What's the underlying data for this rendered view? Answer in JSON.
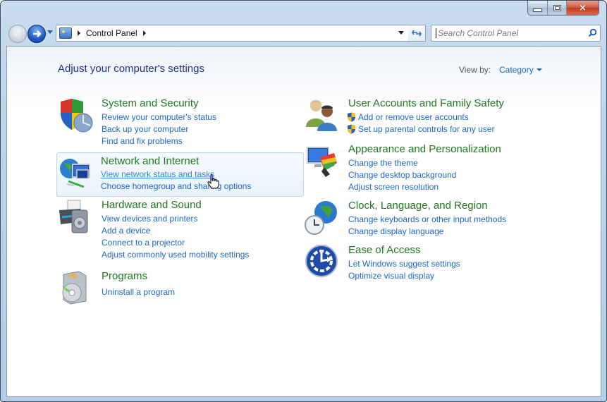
{
  "window": {
    "controls": {
      "minimize": "minimize",
      "maximize": "maximize",
      "close": "×"
    }
  },
  "nav": {
    "back_icon": "back-arrow-icon",
    "forward_icon": "forward-arrow-icon",
    "breadcrumb": [
      "Control Panel"
    ],
    "search_placeholder": "Search Control Panel"
  },
  "main": {
    "heading": "Adjust your computer's settings",
    "view_by_label": "View by:",
    "view_by_value": "Category",
    "categories": [
      {
        "title": "System and Security",
        "icon": "shield-icon",
        "links": [
          "Review your computer's status",
          "Back up your computer",
          "Find and fix problems"
        ]
      },
      {
        "title": "Network and Internet",
        "icon": "network-globe-icon",
        "links": [
          "View network status and tasks",
          "Choose homegroup and sharing options"
        ]
      },
      {
        "title": "Hardware and Sound",
        "icon": "printer-speaker-icon",
        "links": [
          "View devices and printers",
          "Add a device",
          "Connect to a projector",
          "Adjust commonly used mobility settings"
        ]
      },
      {
        "title": "Programs",
        "icon": "programs-disc-icon",
        "links": [
          "Uninstall a program"
        ]
      },
      {
        "title": "User Accounts and Family Safety",
        "icon": "users-icon",
        "links": [
          "Add or remove user accounts",
          "Set up parental controls for any user"
        ]
      },
      {
        "title": "Appearance and Personalization",
        "icon": "monitor-palette-icon",
        "links": [
          "Change the theme",
          "Change desktop background",
          "Adjust screen resolution"
        ]
      },
      {
        "title": "Clock, Language, and Region",
        "icon": "globe-clock-icon",
        "links": [
          "Change keyboards or other input methods",
          "Change display language"
        ]
      },
      {
        "title": "Ease of Access",
        "icon": "ease-of-access-icon",
        "links": [
          "Let Windows suggest settings",
          "Optimize visual display"
        ]
      }
    ]
  },
  "colors": {
    "category_title": "#1d7a1d",
    "link": "#1e66c8",
    "heading": "#1e3287"
  }
}
